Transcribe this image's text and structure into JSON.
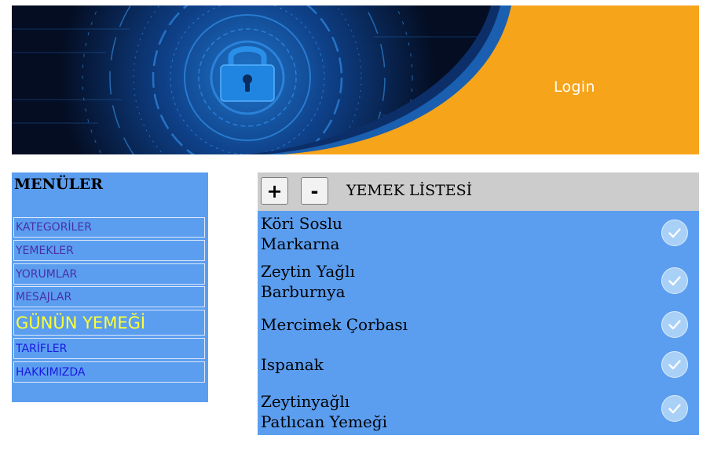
{
  "header": {
    "login_label": "Login"
  },
  "sidebar": {
    "title": "MENÜLER",
    "items": [
      {
        "label": "KATEGORİLER"
      },
      {
        "label": "YEMEKLER"
      },
      {
        "label": "YORUMLAR"
      },
      {
        "label": "MESAJLAR"
      },
      {
        "label": "GÜNÜN YEMEĞİ"
      },
      {
        "label": "TARİFLER"
      },
      {
        "label": "HAKKIMIZDA"
      }
    ]
  },
  "food_list": {
    "add_label": "+",
    "remove_label": "-",
    "title": "YEMEK LİSTESİ",
    "items": [
      {
        "line1": "Köri Soslu",
        "line2": "Markarna"
      },
      {
        "line1": "Zeytin Yağlı",
        "line2": "Barburnya"
      },
      {
        "line1": "Mercimek Çorbası",
        "line2": ""
      },
      {
        "line1": "Ispanak",
        "line2": ""
      },
      {
        "line1": "Zeytinyağlı",
        "line2": "Patlıcan Yemeği"
      }
    ]
  },
  "colors": {
    "panel_blue": "#5b9ef0",
    "header_gray": "#cccccc",
    "banner_orange": "#f6a41a",
    "banner_navy": "#0a1a3a",
    "highlight_yellow": "#ffff33",
    "menu_link_visited": "#4b2fa8",
    "menu_link": "#1a1ae0"
  },
  "icons": {
    "banner": "padlock-icon",
    "add": "plus",
    "remove": "minus",
    "check": "check-circle-icon"
  }
}
